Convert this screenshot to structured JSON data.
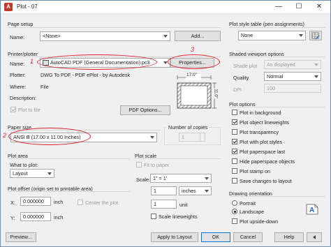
{
  "window": {
    "title": "Plot - 07",
    "app_icon": "A",
    "controls": [
      "—",
      "☐",
      "✕"
    ]
  },
  "page_setup": {
    "group_label": "Page setup",
    "name_label": "Name:",
    "name_value": "<None>",
    "add_button": "Add..."
  },
  "printer": {
    "group_label": "Printer/plotter",
    "name_label": "Name:",
    "name_value": "AutoCAD PDF (General Documentation).pc3",
    "properties_button": "Properties...",
    "plotter_label": "Plotter:",
    "plotter_value": "DWG To PDF - PDF ePlot - by Autodesk",
    "where_label": "Where:",
    "where_value": "File",
    "description_label": "Description:",
    "plot_to_file_label": "Plot to file",
    "pdf_options_button": "PDF Options...",
    "preview_width": "17.0\"",
    "preview_height": "11.0\""
  },
  "annotations": {
    "one": "1",
    "two": "2",
    "three": "3"
  },
  "paper_size": {
    "group_label": "Paper size",
    "value": "ANSI B (17.00 x 11.00 Inches)"
  },
  "copies": {
    "group_label": "Number of copies",
    "value": "1"
  },
  "plot_area": {
    "group_label": "Plot area",
    "what_label": "What to plot:",
    "what_value": "Layout"
  },
  "plot_offset": {
    "group_label": "Plot offset (origin set to printable area)",
    "x_label": "X:",
    "x_value": "0.000000",
    "x_unit": "inch",
    "y_label": "Y:",
    "y_value": "0.000000",
    "y_unit": "inch",
    "center_label": "Center the plot"
  },
  "plot_scale": {
    "group_label": "Plot scale",
    "fit_label": "Fit to paper",
    "scale_label": "Scale:",
    "scale_value": "1\" = 1'",
    "value1": "1",
    "unit1": "inches",
    "value2": "1",
    "unit2": "unit",
    "lineweights_label": "Scale lineweights"
  },
  "plot_style_table": {
    "group_label": "Plot style table (pen assignments)",
    "value": "None"
  },
  "shaded": {
    "group_label": "Shaded viewport options",
    "shade_label": "Shade plot",
    "shade_value": "As displayed",
    "quality_label": "Quality",
    "quality_value": "Normal",
    "dpi_label": "DPI",
    "dpi_value": "100"
  },
  "plot_options": {
    "group_label": "Plot options",
    "items": [
      {
        "label": "Plot in background",
        "checked": false,
        "enabled": true
      },
      {
        "label": "Plot object lineweights",
        "checked": true,
        "enabled": true
      },
      {
        "label": "Plot transparency",
        "checked": false,
        "enabled": true
      },
      {
        "label": "Plot with plot styles",
        "checked": true,
        "enabled": true
      },
      {
        "label": "Plot paperspace last",
        "checked": true,
        "enabled": true
      },
      {
        "label": "Hide paperspace objects",
        "checked": false,
        "enabled": true
      },
      {
        "label": "Plot stamp on",
        "checked": false,
        "enabled": true
      },
      {
        "label": "Save changes to layout",
        "checked": false,
        "enabled": true
      }
    ]
  },
  "orientation": {
    "group_label": "Drawing orientation",
    "portrait": "Portrait",
    "landscape": "Landscape",
    "upside_down": "Plot upside-down",
    "selected": "Landscape"
  },
  "footer": {
    "preview": "Preview...",
    "apply": "Apply to Layout",
    "ok": "OK",
    "cancel": "Cancel",
    "help": "Help"
  },
  "accent_color": "#e0202a"
}
